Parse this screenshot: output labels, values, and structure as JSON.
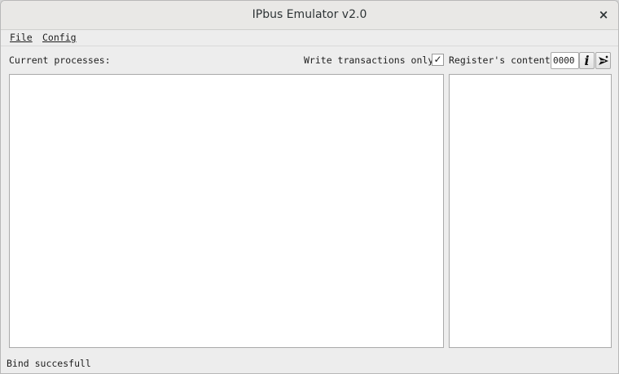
{
  "window": {
    "title": "IPbus Emulator v2.0",
    "close_label": "×"
  },
  "menu": {
    "file": "File",
    "config": "Config"
  },
  "toolbar": {
    "processes_label": "Current processes:",
    "write_only_label": "Write transactions only",
    "write_only_checked": true,
    "checkbox_mark": "✓",
    "register_label": "Register's content",
    "register_value": "0000",
    "info_button_glyph": "i",
    "info_icon": "info-icon",
    "send_icon": "send-icon"
  },
  "panels": {
    "processes_items": [],
    "register_items": []
  },
  "status": {
    "text": "Bind succesfull"
  },
  "colors": {
    "window_bg": "#ededed",
    "titlebar_bg": "#e9e8e6",
    "panel_bg": "#ffffff",
    "border": "#a9a9a9"
  }
}
